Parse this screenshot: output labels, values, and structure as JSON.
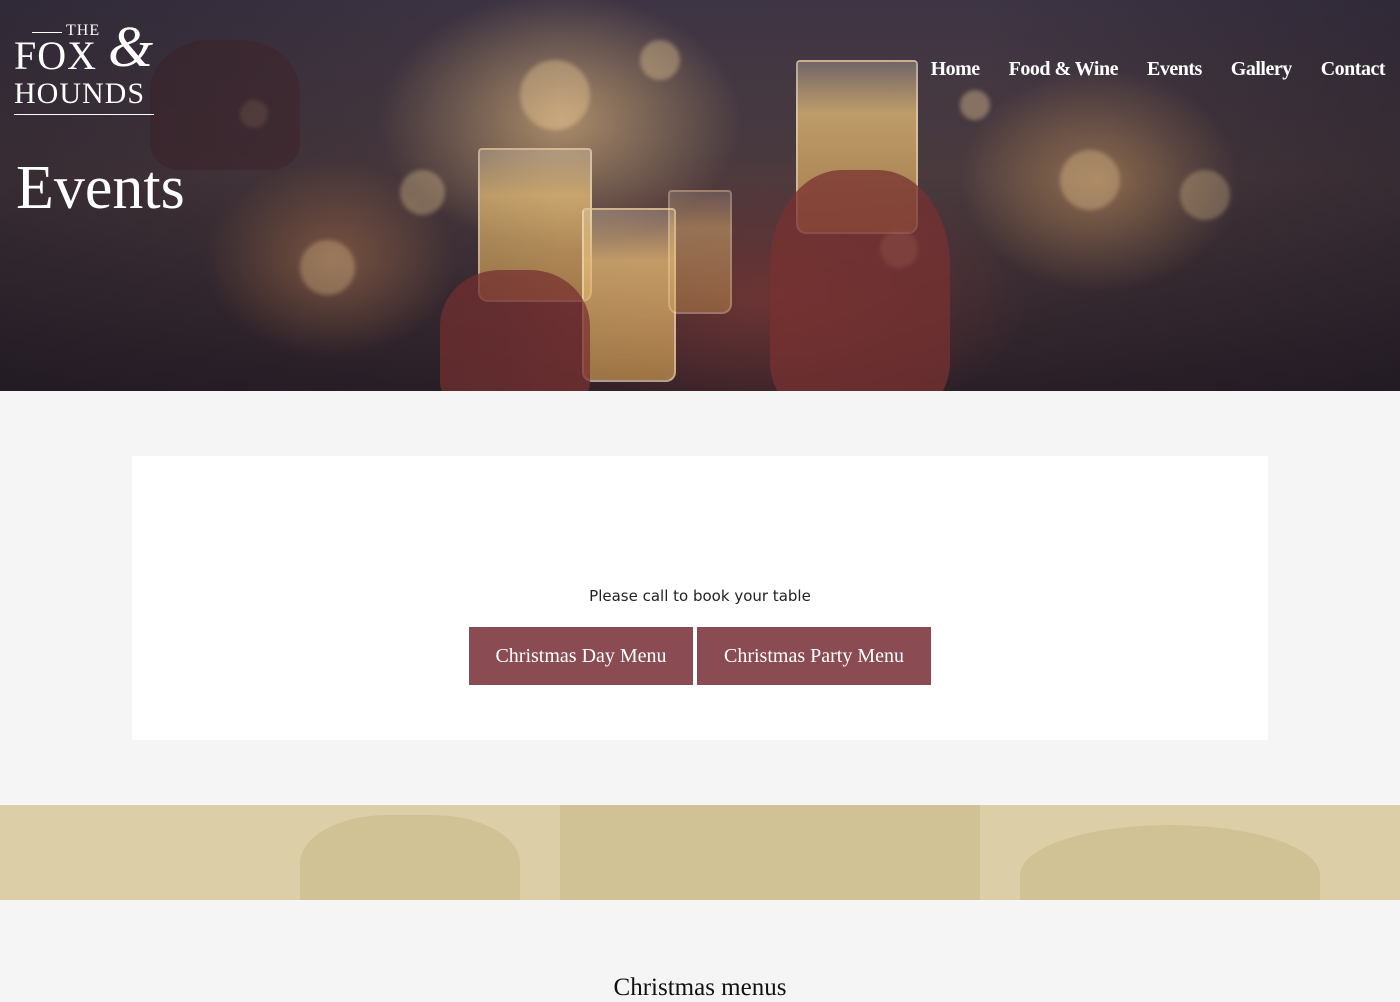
{
  "brand": {
    "the": "THE",
    "fox": "FOX",
    "ampersand": "&",
    "hounds": "HOUNDS"
  },
  "nav": {
    "items": [
      "Home",
      "Food & Wine",
      "Events",
      "Gallery",
      "Contact"
    ]
  },
  "hero": {
    "title": "Events"
  },
  "section": {
    "heading": "Christmas menus",
    "subtext": "Please call to book your table",
    "buttons": [
      "Christmas Day Menu",
      "Christmas Party Menu"
    ]
  },
  "colors": {
    "button": "#8b4b52",
    "page_background": "#f5f5f5",
    "footer_band": "#dccfa7"
  }
}
